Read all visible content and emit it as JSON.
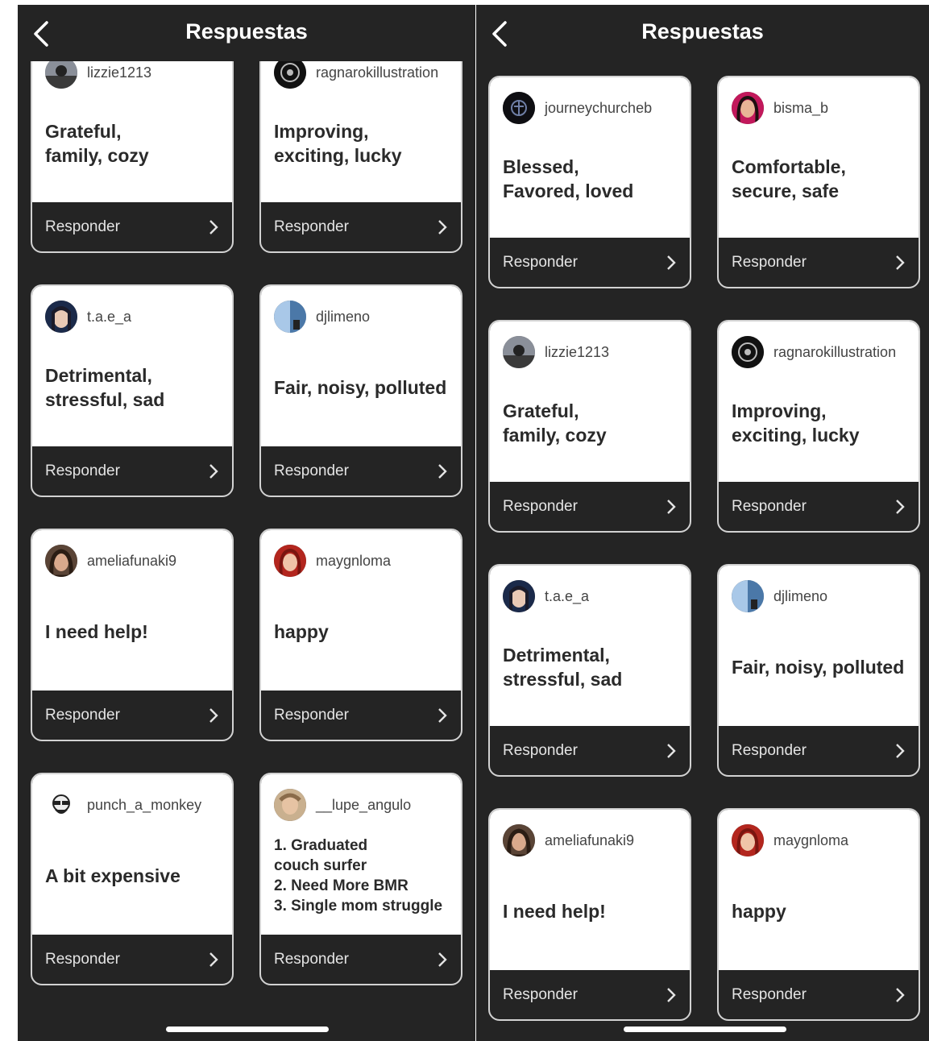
{
  "header": {
    "title": "Respuestas"
  },
  "reply_label": "Responder",
  "left_screen": {
    "cards": [
      {
        "user": "lizzie1213",
        "text": "Grateful,\nfamily, cozy",
        "avatar": "photo"
      },
      {
        "user": "ragnarokillustration",
        "text": "Improving,\nexciting, lucky",
        "avatar": "logo"
      },
      {
        "user": "t.a.e_a",
        "text": "Detrimental,\nstressful, sad",
        "avatar": "photo"
      },
      {
        "user": "djlimeno",
        "text": "Fair, noisy, polluted",
        "avatar": "photo"
      },
      {
        "user": "ameliafunaki9",
        "text": "I need help!",
        "avatar": "photo"
      },
      {
        "user": "maygnloma",
        "text": "happy",
        "avatar": "photo"
      },
      {
        "user": "punch_a_monkey",
        "text": "A bit expensive",
        "avatar": "illustration"
      },
      {
        "user": "__lupe_angulo",
        "text": "1. Graduated\ncouch surfer\n2. Need More BMR\n3. Single mom struggle",
        "avatar": "photo"
      }
    ]
  },
  "right_screen": {
    "cards": [
      {
        "user": "journeychurcheb",
        "text": "Blessed,\nFavored, loved",
        "avatar": "logo"
      },
      {
        "user": "bisma_b",
        "text": "Comfortable,\nsecure, safe",
        "avatar": "photo"
      },
      {
        "user": "lizzie1213",
        "text": "Grateful,\nfamily, cozy",
        "avatar": "photo"
      },
      {
        "user": "ragnarokillustration",
        "text": "Improving,\nexciting, lucky",
        "avatar": "logo"
      },
      {
        "user": "t.a.e_a",
        "text": "Detrimental,\nstressful, sad",
        "avatar": "photo"
      },
      {
        "user": "djlimeno",
        "text": "Fair, noisy, polluted",
        "avatar": "photo"
      },
      {
        "user": "ameliafunaki9",
        "text": "I need help!",
        "avatar": "photo"
      },
      {
        "user": "maygnloma",
        "text": "happy",
        "avatar": "photo"
      }
    ]
  },
  "colors": {
    "background": "#242424",
    "card": "#ffffff",
    "text": "#2a2a2a",
    "border": "#d2d2d2"
  }
}
